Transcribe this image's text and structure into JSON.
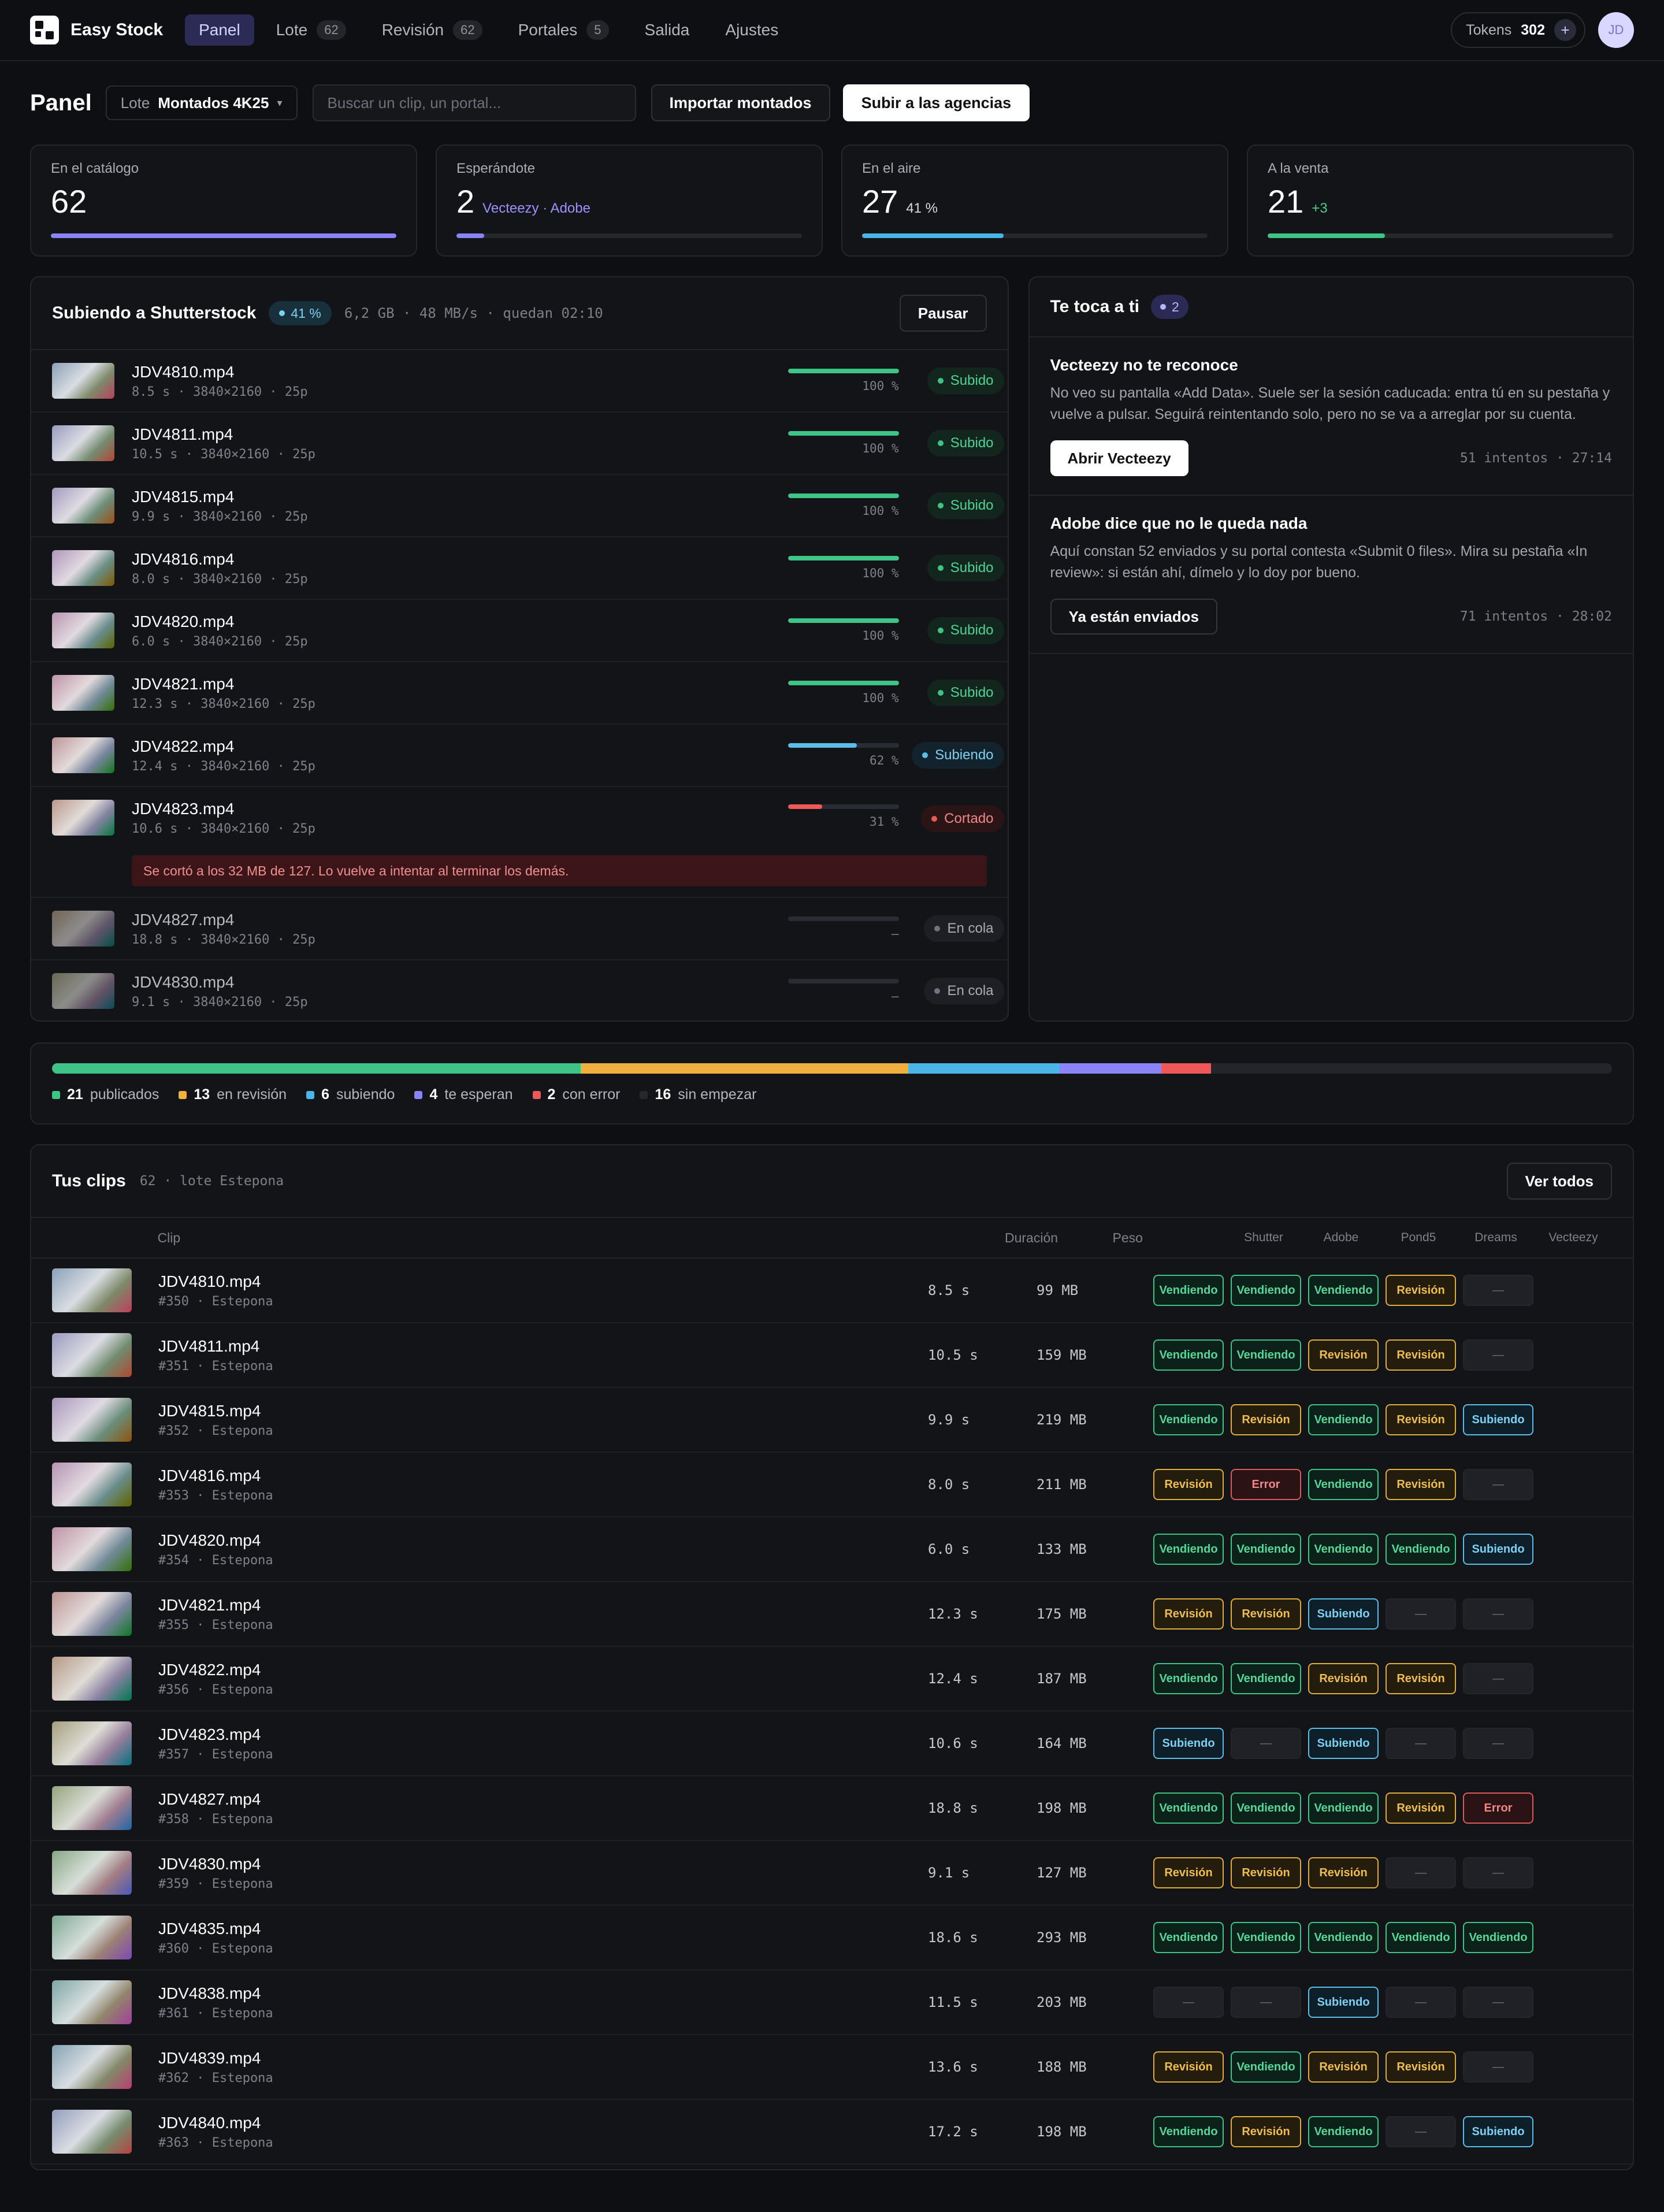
{
  "app": {
    "name": "Easy Stock"
  },
  "nav": [
    {
      "label": "Panel",
      "badge": "",
      "active": true
    },
    {
      "label": "Lote",
      "badge": "62",
      "active": false
    },
    {
      "label": "Revisión",
      "badge": "62",
      "active": false
    },
    {
      "label": "Portales",
      "badge": "5",
      "active": false
    },
    {
      "label": "Salida",
      "badge": "",
      "active": false
    },
    {
      "label": "Ajustes",
      "badge": "",
      "active": false
    }
  ],
  "tokens": {
    "label": "Tokens",
    "value": "302",
    "add": "+"
  },
  "user": {
    "initials": "JD"
  },
  "header": {
    "title": "Panel",
    "lote_label": "Lote",
    "lote_value": "Montados 4K25",
    "lote_caret": "▾",
    "search_placeholder": "Buscar un clip, un portal...",
    "import_btn": "Importar montados",
    "upload_btn": "Subir a las agencias"
  },
  "stats": [
    {
      "label": "En el catálogo",
      "value": "62",
      "sub": "",
      "sub_color": "#9aa0ff",
      "fill": 1.0,
      "color": "#8b84f7"
    },
    {
      "label": "Esperándote",
      "value": "2",
      "sub": "Vecteezy · Adobe",
      "sub_color": "#9a92ff",
      "fill": 0.08,
      "color": "#8b84f7"
    },
    {
      "label": "En el aire",
      "value": "27",
      "sub": "41 %",
      "sub_color": "#d8dae0",
      "fill": 0.41,
      "color": "#4bb5e8"
    },
    {
      "label": "A la venta",
      "value": "21",
      "sub": "+3",
      "sub_color": "#46cf8a",
      "fill": 0.34,
      "color": "#3ec487"
    }
  ],
  "upload": {
    "title": "Subiendo a Shutterstock",
    "pct": "41 %",
    "meta": "6,2 GB · 48 MB/s · quedan 02:10",
    "pause_btn": "Pausar",
    "items": [
      {
        "name": "JDV4810.mp4",
        "meta": "8.5 s · 3840×2160 · 25p",
        "progress": 1.0,
        "pct": "100 %",
        "status": "Subido",
        "kind": "ok"
      },
      {
        "name": "JDV4811.mp4",
        "meta": "10.5 s · 3840×2160 · 25p",
        "progress": 1.0,
        "pct": "100 %",
        "status": "Subido",
        "kind": "ok"
      },
      {
        "name": "JDV4815.mp4",
        "meta": "9.9 s · 3840×2160 · 25p",
        "progress": 1.0,
        "pct": "100 %",
        "status": "Subido",
        "kind": "ok"
      },
      {
        "name": "JDV4816.mp4",
        "meta": "8.0 s · 3840×2160 · 25p",
        "progress": 1.0,
        "pct": "100 %",
        "status": "Subido",
        "kind": "ok"
      },
      {
        "name": "JDV4820.mp4",
        "meta": "6.0 s · 3840×2160 · 25p",
        "progress": 1.0,
        "pct": "100 %",
        "status": "Subido",
        "kind": "ok"
      },
      {
        "name": "JDV4821.mp4",
        "meta": "12.3 s · 3840×2160 · 25p",
        "progress": 1.0,
        "pct": "100 %",
        "status": "Subido",
        "kind": "ok"
      },
      {
        "name": "JDV4822.mp4",
        "meta": "12.4 s · 3840×2160 · 25p",
        "progress": 0.62,
        "pct": "62 %",
        "status": "Subiendo",
        "kind": "up"
      },
      {
        "name": "JDV4823.mp4",
        "meta": "10.6 s · 3840×2160 · 25p",
        "progress": 0.31,
        "pct": "31 %",
        "status": "Cortado",
        "kind": "err",
        "error": "Se cortó a los 32 MB de 127. Lo vuelve a intentar al terminar los demás."
      },
      {
        "name": "JDV4827.mp4",
        "meta": "18.8 s · 3840×2160 · 25p",
        "progress": 0,
        "pct": "—",
        "status": "En cola",
        "kind": "queue"
      },
      {
        "name": "JDV4830.mp4",
        "meta": "9.1 s · 3840×2160 · 25p",
        "progress": 0,
        "pct": "—",
        "status": "En cola",
        "kind": "queue"
      }
    ]
  },
  "tasks": {
    "title": "Te toca a ti",
    "count": "2",
    "items": [
      {
        "title": "Vecteezy no te reconoce",
        "text": "No veo su pantalla «Add Data». Suele ser la sesión caducada: entra tú en su pestaña y vuelve a pulsar. Seguirá reintentando solo, pero no se va a arreglar por su cuenta.",
        "button": "Abrir Vecteezy",
        "primary": true,
        "meta": "51 intentos · 27:14"
      },
      {
        "title": "Adobe dice que no le queda nada",
        "text": "Aquí constan 52 enviados y su portal contesta «Submit 0 files». Mira su pestaña «In review»: si están ahí, dímelo y lo doy por bueno.",
        "button": "Ya están enviados",
        "primary": false,
        "meta": "71 intentos · 28:02"
      }
    ]
  },
  "summary": {
    "segments": [
      {
        "count": "21",
        "label": "publicados",
        "color": "#3ec487",
        "fraction": 0.339
      },
      {
        "count": "13",
        "label": "en revisión",
        "color": "#f0b03e",
        "fraction": 0.21
      },
      {
        "count": "6",
        "label": "subiendo",
        "color": "#4bb5e8",
        "fraction": 0.097
      },
      {
        "count": "4",
        "label": "te esperan",
        "color": "#8b84f7",
        "fraction": 0.065
      },
      {
        "count": "2",
        "label": "con error",
        "color": "#ef5858",
        "fraction": 0.032
      },
      {
        "count": "16",
        "label": "sin empezar",
        "color": "#25272d",
        "fraction": 0
      }
    ]
  },
  "clips": {
    "title": "Tus clips",
    "meta": "62 · lote Estepona",
    "view_all": "Ver todos",
    "columns": {
      "clip": "Clip",
      "duration": "Duración",
      "weight": "Peso",
      "portals": [
        "Shutter",
        "Adobe",
        "Pond5",
        "Dreams",
        "Vecteezy"
      ]
    },
    "rows": [
      {
        "name": "JDV4810.mp4",
        "id": "#350 · Estepona",
        "dur": "8.5 s",
        "peso": "99 MB",
        "portals": [
          "Vendiendo",
          "Vendiendo",
          "Vendiendo",
          "Revisión",
          "—"
        ]
      },
      {
        "name": "JDV4811.mp4",
        "id": "#351 · Estepona",
        "dur": "10.5 s",
        "peso": "159 MB",
        "portals": [
          "Vendiendo",
          "Vendiendo",
          "Revisión",
          "Revisión",
          "—"
        ]
      },
      {
        "name": "JDV4815.mp4",
        "id": "#352 · Estepona",
        "dur": "9.9 s",
        "peso": "219 MB",
        "portals": [
          "Vendiendo",
          "Revisión",
          "Vendiendo",
          "Revisión",
          "Subiendo"
        ]
      },
      {
        "name": "JDV4816.mp4",
        "id": "#353 · Estepona",
        "dur": "8.0 s",
        "peso": "211 MB",
        "portals": [
          "Revisión",
          "Error",
          "Vendiendo",
          "Revisión",
          "—"
        ]
      },
      {
        "name": "JDV4820.mp4",
        "id": "#354 · Estepona",
        "dur": "6.0 s",
        "peso": "133 MB",
        "portals": [
          "Vendiendo",
          "Vendiendo",
          "Vendiendo",
          "Vendiendo",
          "Subiendo"
        ]
      },
      {
        "name": "JDV4821.mp4",
        "id": "#355 · Estepona",
        "dur": "12.3 s",
        "peso": "175 MB",
        "portals": [
          "Revisión",
          "Revisión",
          "Subiendo",
          "—",
          "—"
        ]
      },
      {
        "name": "JDV4822.mp4",
        "id": "#356 · Estepona",
        "dur": "12.4 s",
        "peso": "187 MB",
        "portals": [
          "Vendiendo",
          "Vendiendo",
          "Revisión",
          "Revisión",
          "—"
        ]
      },
      {
        "name": "JDV4823.mp4",
        "id": "#357 · Estepona",
        "dur": "10.6 s",
        "peso": "164 MB",
        "portals": [
          "Subiendo",
          "—",
          "Subiendo",
          "—",
          "—"
        ]
      },
      {
        "name": "JDV4827.mp4",
        "id": "#358 · Estepona",
        "dur": "18.8 s",
        "peso": "198 MB",
        "portals": [
          "Vendiendo",
          "Vendiendo",
          "Vendiendo",
          "Revisión",
          "Error"
        ]
      },
      {
        "name": "JDV4830.mp4",
        "id": "#359 · Estepona",
        "dur": "9.1 s",
        "peso": "127 MB",
        "portals": [
          "Revisión",
          "Revisión",
          "Revisión",
          "—",
          "—"
        ]
      },
      {
        "name": "JDV4835.mp4",
        "id": "#360 · Estepona",
        "dur": "18.6 s",
        "peso": "293 MB",
        "portals": [
          "Vendiendo",
          "Vendiendo",
          "Vendiendo",
          "Vendiendo",
          "Vendiendo"
        ]
      },
      {
        "name": "JDV4838.mp4",
        "id": "#361 · Estepona",
        "dur": "11.5 s",
        "peso": "203 MB",
        "portals": [
          "—",
          "—",
          "Subiendo",
          "—",
          "—"
        ]
      },
      {
        "name": "JDV4839.mp4",
        "id": "#362 · Estepona",
        "dur": "13.6 s",
        "peso": "188 MB",
        "portals": [
          "Revisión",
          "Vendiendo",
          "Revisión",
          "Revisión",
          "—"
        ]
      },
      {
        "name": "JDV4840.mp4",
        "id": "#363 · Estepona",
        "dur": "17.2 s",
        "peso": "198 MB",
        "portals": [
          "Vendiendo",
          "Revisión",
          "Vendiendo",
          "—",
          "Subiendo"
        ]
      }
    ]
  }
}
